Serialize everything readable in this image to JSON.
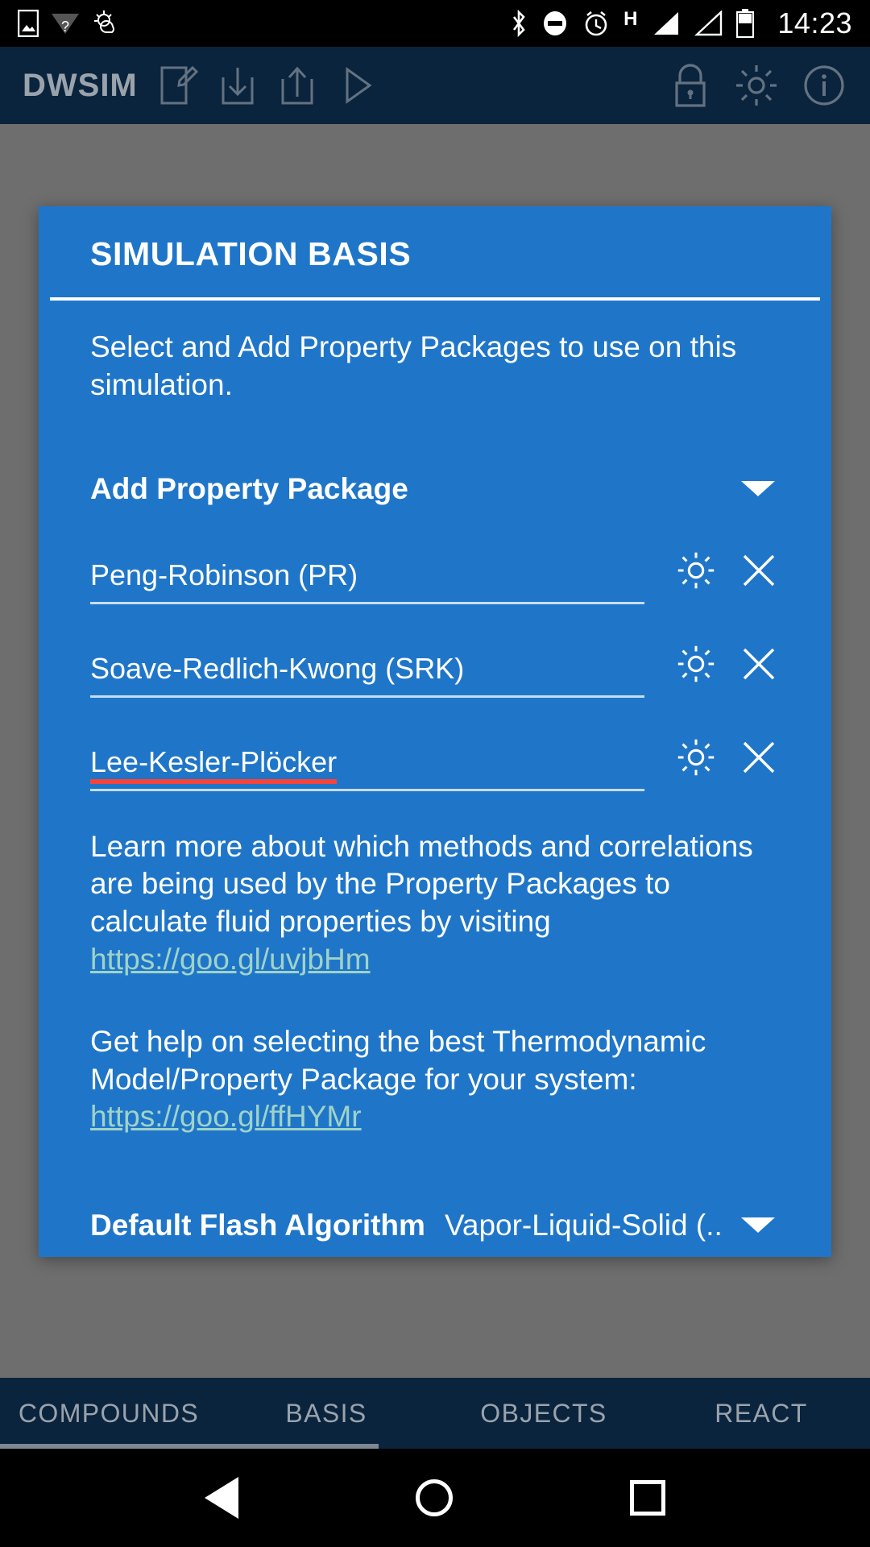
{
  "status_bar": {
    "time": "14:23",
    "network_type": "H",
    "icons": [
      "image-icon",
      "wifi-question-icon",
      "weather-icon",
      "bluetooth-icon",
      "do-not-disturb-icon",
      "alarm-icon",
      "signal-bar-icon",
      "signal-bar-empty-icon",
      "battery-icon"
    ]
  },
  "app_bar": {
    "title": "DWSIM",
    "left_icons": [
      "new-document-icon",
      "save-icon",
      "share-icon",
      "run-icon"
    ],
    "right_icons": [
      "lock-icon",
      "settings-gear-icon",
      "info-icon"
    ]
  },
  "card": {
    "title": "SIMULATION BASIS",
    "description": "Select and Add Property Packages to use on this simulation.",
    "add_package": {
      "label": "Add Property Package",
      "caret": "chevron-down-icon"
    },
    "packages": [
      {
        "name": "Peng-Robinson (PR)",
        "misspelled": false
      },
      {
        "name": "Soave-Redlich-Kwong (SRK)",
        "misspelled": false
      },
      {
        "name": "Lee-Kesler-Plöcker",
        "misspelled": true
      }
    ],
    "package_actions": {
      "settings": "settings-gear-icon",
      "remove": "close-x-icon"
    },
    "info_paragraph_1": {
      "text_before": "Learn more about which methods and correlations are being used by the Property Packages to calculate fluid properties by visiting ",
      "link": "https://goo.gl/uvjbHm"
    },
    "info_paragraph_2": {
      "text_before": "Get help on selecting the best Thermodynamic Model/Property Package for your system: ",
      "link": "https://goo.gl/ffHYMr"
    },
    "flash_algorithm": {
      "label": "Default Flash Algorithm",
      "value": "Vapor-Liquid-Solid (..",
      "caret": "chevron-down-icon"
    }
  },
  "tabs": [
    {
      "label": "COMPOUNDS",
      "selected": false
    },
    {
      "label": "BASIS",
      "selected": true
    },
    {
      "label": "OBJECTS",
      "selected": false
    },
    {
      "label": "REACT",
      "selected": false
    }
  ],
  "nav_bar": {
    "back": "back-triangle-icon",
    "home": "home-circle-icon",
    "recents": "recents-square-icon"
  },
  "colors": {
    "card_blue": "#1f76c9",
    "appbar_blue": "#123a63",
    "link_teal": "#9fd3c7",
    "spellcheck_red": "#f4443c",
    "scrim_gray": "#6e6e6e"
  }
}
